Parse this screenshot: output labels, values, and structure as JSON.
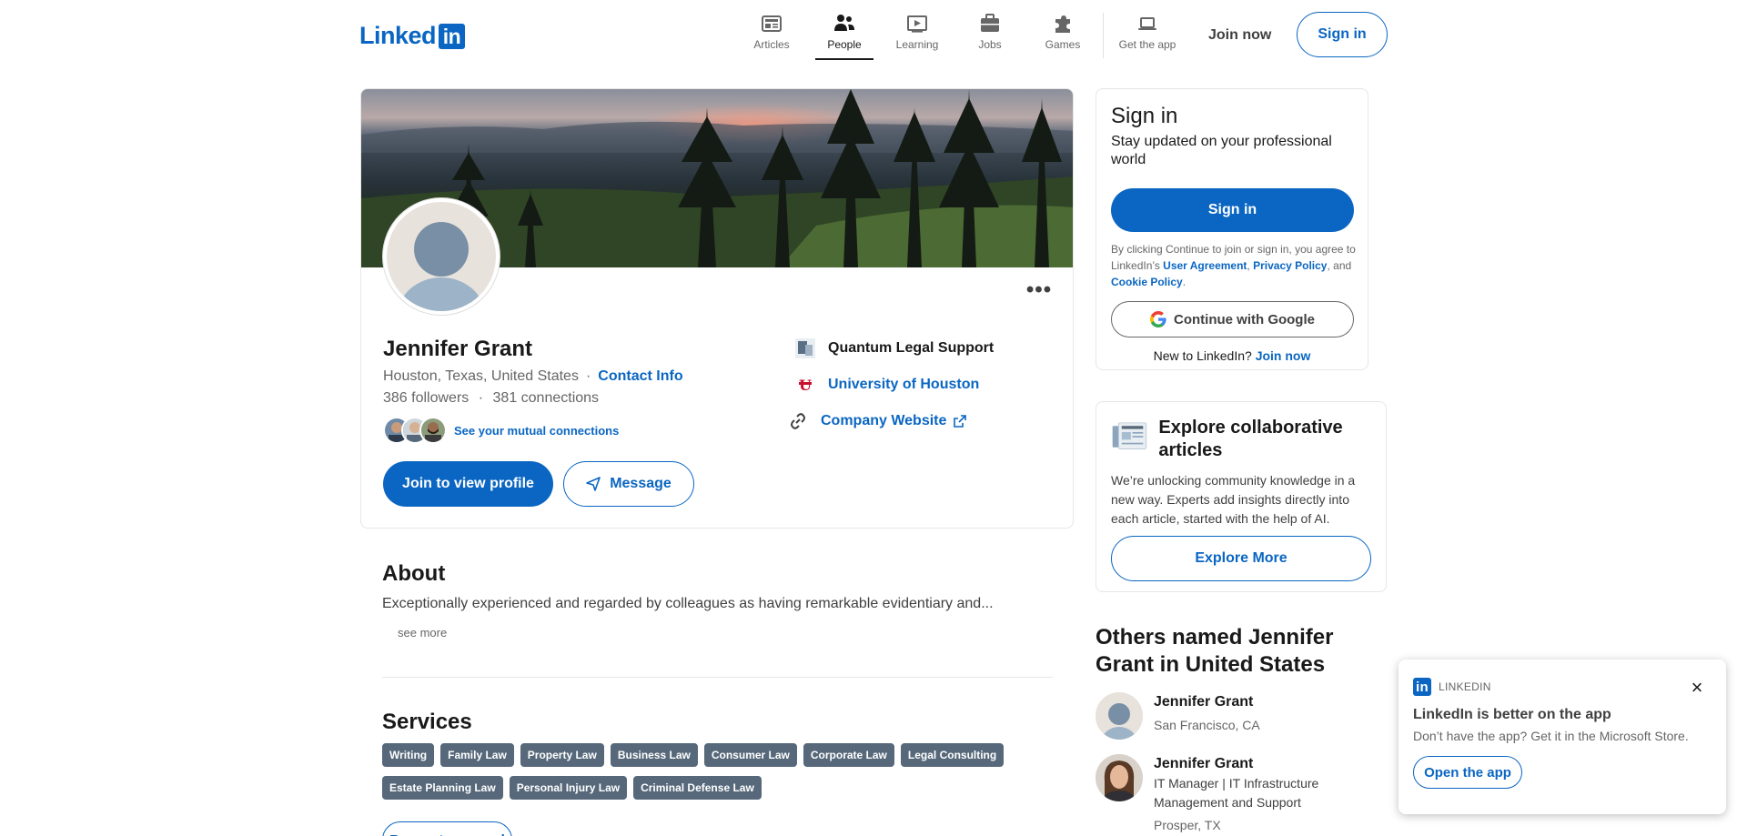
{
  "nav": {
    "logo_text": "Linked",
    "logo_box": "in",
    "items": [
      {
        "label": "Articles",
        "icon": "articles-icon"
      },
      {
        "label": "People",
        "icon": "people-icon"
      },
      {
        "label": "Learning",
        "icon": "learning-icon"
      },
      {
        "label": "Jobs",
        "icon": "jobs-icon"
      },
      {
        "label": "Games",
        "icon": "games-icon"
      },
      {
        "label": "Get the app",
        "icon": "laptop-icon"
      }
    ],
    "active_item": "People",
    "join_now": "Join now",
    "sign_in": "Sign in"
  },
  "profile": {
    "name": "Jennifer Grant",
    "location": "Houston, Texas, United States",
    "location_sep": "·",
    "contact_info": "Contact Info",
    "followers": "386 followers",
    "stats_sep": "·",
    "connections": "381 connections",
    "mutual_link": "See your mutual connections",
    "join_button": "Join to view profile",
    "message_button": "Message",
    "more_label": "•••",
    "company": "Quantum Legal Support",
    "school": "University of Houston",
    "website": "Company Website"
  },
  "about": {
    "title": "About",
    "text": "Exceptionally experienced and regarded by colleagues as having remarkable evidentiary and...",
    "see_more": "see more"
  },
  "services": {
    "title": "Services",
    "tags": [
      "Writing",
      "Family Law",
      "Property Law",
      "Business Law",
      "Consumer Law",
      "Corporate Law",
      "Legal Consulting",
      "Estate Planning Law",
      "Personal Injury Law",
      "Criminal Defense Law"
    ],
    "request_button": "Request proposal"
  },
  "signin_card": {
    "title": "Sign in",
    "subtitle": "Stay updated on your professional world",
    "button": "Sign in",
    "legal_prefix": "By clicking Continue to join or sign in, you agree to LinkedIn’s ",
    "user_agreement": "User Agreement",
    "comma": ", ",
    "privacy_policy": "Privacy Policy",
    "and": ", and ",
    "cookie_policy": "Cookie Policy",
    "period": ".",
    "google_button": "Continue with Google",
    "new_to": "New to LinkedIn? ",
    "join_now": "Join now"
  },
  "explore": {
    "title": "Explore collaborative articles",
    "text": "We’re unlocking community knowledge in a new way. Experts add insights directly into each article, started with the help of AI.",
    "button": "Explore More"
  },
  "others": {
    "prefix": "Others named ",
    "name": "Jennifer Grant",
    "in": " in ",
    "region": "United States",
    "people": [
      {
        "name": "Jennifer Grant",
        "desc": "",
        "loc": "San Francisco, CA"
      },
      {
        "name": "Jennifer Grant",
        "desc": "IT Manager | IT Infrastructure Management and Support",
        "loc": "Prosper, TX"
      }
    ]
  },
  "toast": {
    "brand": "LINKEDIN",
    "title": "LinkedIn is better on the app",
    "text": "Don’t have the app? Get it in the Microsoft Store.",
    "button": "Open the app",
    "close": "×"
  },
  "colors": {
    "brand": "#0a66c2",
    "tag_bg": "#56687a"
  }
}
